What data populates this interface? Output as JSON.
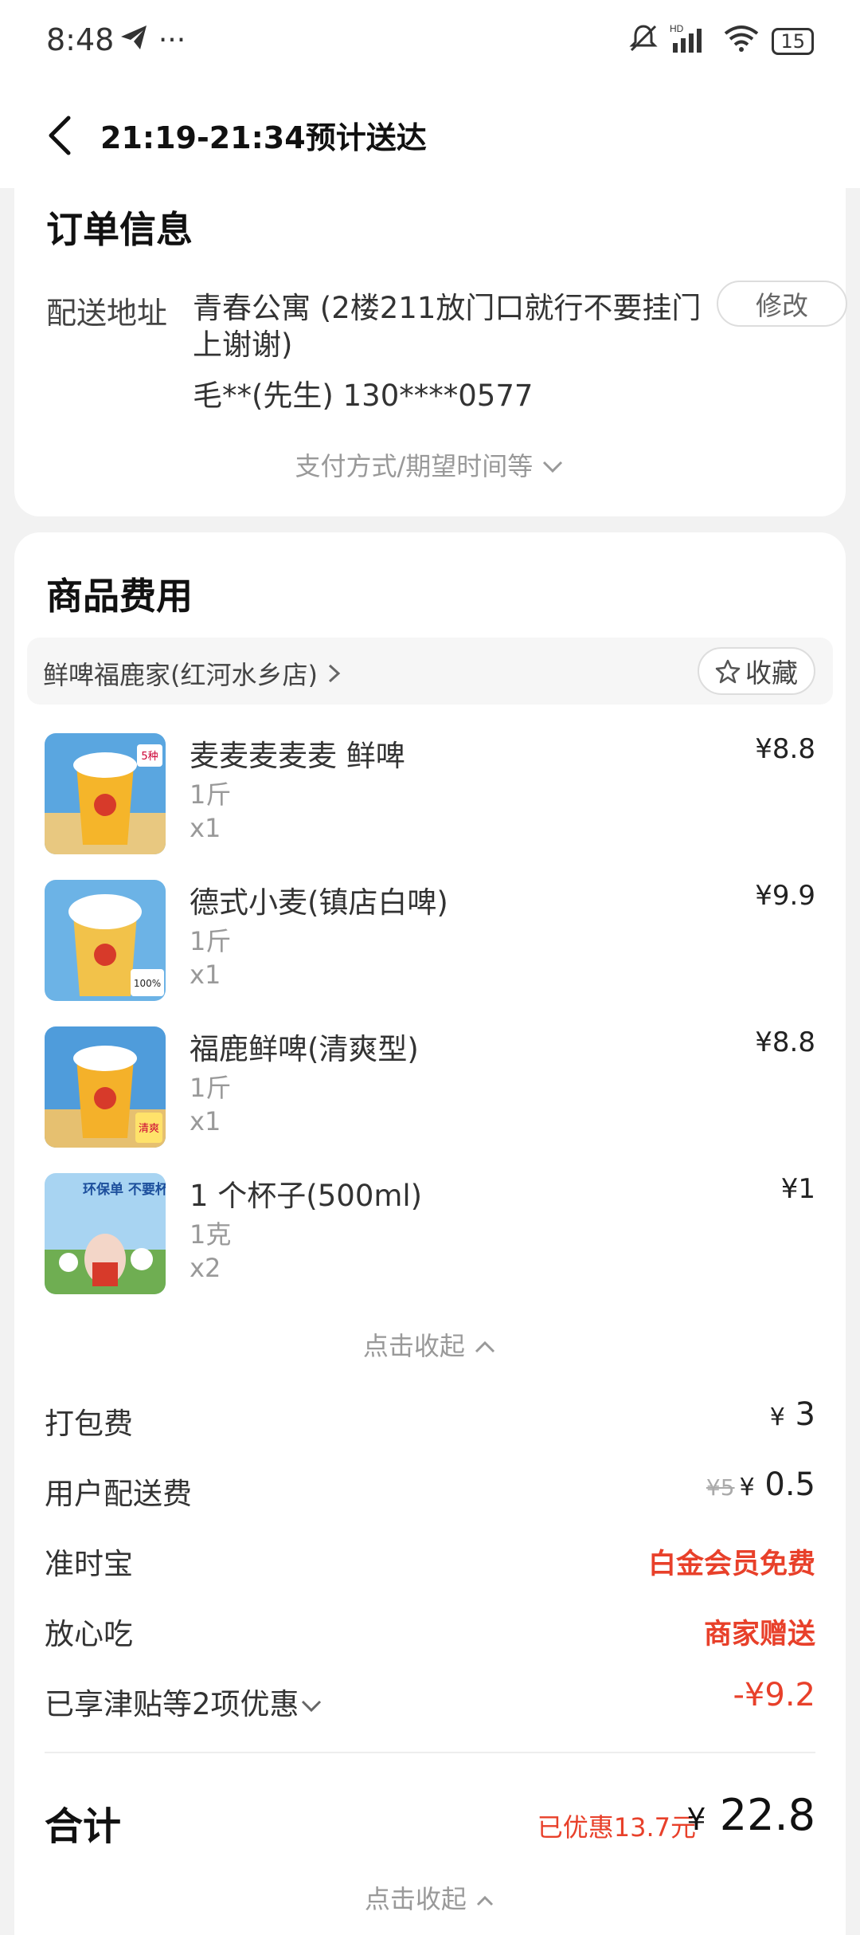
{
  "status_bar": {
    "time": "8:48",
    "left_icons": "◤ ···",
    "signal": "HD",
    "battery": "15"
  },
  "header": {
    "title": "21:19-21:34预计送达"
  },
  "order_info": {
    "title": "订单信息",
    "address_label": "配送地址",
    "address": "青春公寓 (2楼211放门口就行不要挂门上谢谢)",
    "contact": "毛**(先生) 130****0577",
    "modify_button": "修改",
    "payment_toggle": "支付方式/期望时间等"
  },
  "goods": {
    "title": "商品费用",
    "store_name": "鲜啤福鹿家(红河水乡店)",
    "favorite_button": "收藏",
    "items": [
      {
        "name": "麦麦麦麦麦 鲜啤",
        "spec": "1斤",
        "qty": "x1",
        "price": "¥8.8",
        "badge": "5种"
      },
      {
        "name": "德式小麦(镇店白啤)",
        "spec": "1斤",
        "qty": "x1",
        "price": "¥9.9",
        "badge": "100%"
      },
      {
        "name": "福鹿鲜啤(清爽型)",
        "spec": "1斤",
        "qty": "x1",
        "price": "¥8.8",
        "badge": "清爽"
      },
      {
        "name": "1 个杯子(500ml)",
        "spec": "1克",
        "qty": "x2",
        "price": "¥1",
        "badge": "环保单 不要杯子"
      }
    ],
    "collapse_label": "点击收起"
  },
  "fees": {
    "packing": {
      "label": "打包费",
      "yen": "¥",
      "value": "3"
    },
    "delivery": {
      "label": "用户配送费",
      "old": "¥5",
      "yen": "¥",
      "value": "0.5"
    },
    "ontime": {
      "label": "准时宝",
      "value": "白金会员免费"
    },
    "safe": {
      "label": "放心吃",
      "value": "商家赠送"
    },
    "discount": {
      "label": "已享津贴等2项优惠",
      "value": "-¥9.2"
    }
  },
  "total": {
    "label": "合计",
    "discount": "已优惠13.7元",
    "yen": "¥",
    "value": "22.8"
  },
  "bottom_collapse": "点击收起",
  "colors": {
    "accent_red": "#e8402a",
    "background": "#f2f2f2"
  }
}
